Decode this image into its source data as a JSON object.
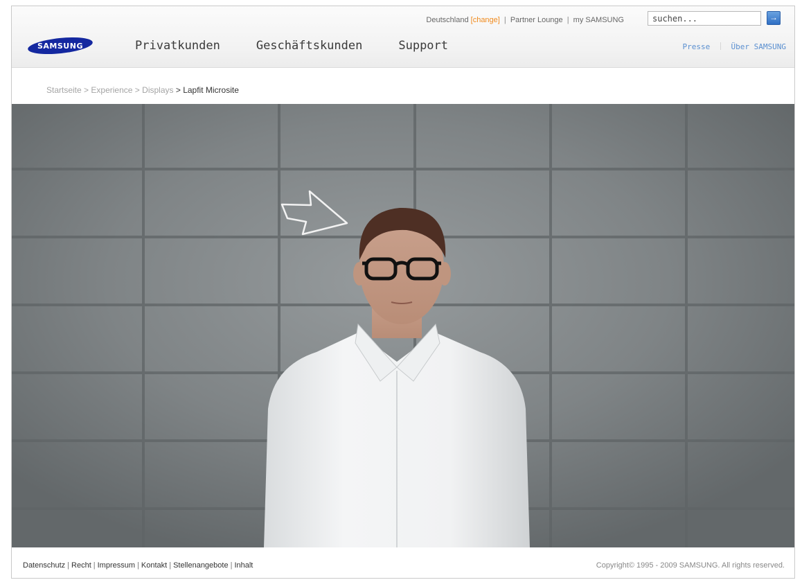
{
  "header": {
    "country": "Deutschland",
    "change_label": "[change]",
    "partner_lounge": "Partner Lounge",
    "my_samsung": "my SAMSUNG",
    "search_placeholder": "suchen...",
    "search_button_icon": "arrow-right-icon",
    "logo_text": "SAMSUNG",
    "nav": [
      {
        "label": "Privatkunden"
      },
      {
        "label": "Geschäftskunden"
      },
      {
        "label": "Support"
      }
    ],
    "presse": "Presse",
    "ueber_samsung": "Über SAMSUNG"
  },
  "breadcrumb": {
    "items": [
      "Startseite",
      "Experience",
      "Displays"
    ],
    "separator": ">",
    "current": "> Lapfit Microsite"
  },
  "footer": {
    "links": [
      {
        "label": "Datenschutz"
      },
      {
        "label": "Recht"
      },
      {
        "label": "Impressum"
      },
      {
        "label": "Kontakt"
      },
      {
        "label": "Stellenangebote"
      },
      {
        "label": "Inhalt"
      }
    ],
    "copyright": "Copyright© 1995 - 2009 SAMSUNG. All rights reserved."
  },
  "colors": {
    "accent_blue": "#1428a0",
    "link_blue": "#5a8fd0",
    "change_orange": "#f08a1c"
  }
}
